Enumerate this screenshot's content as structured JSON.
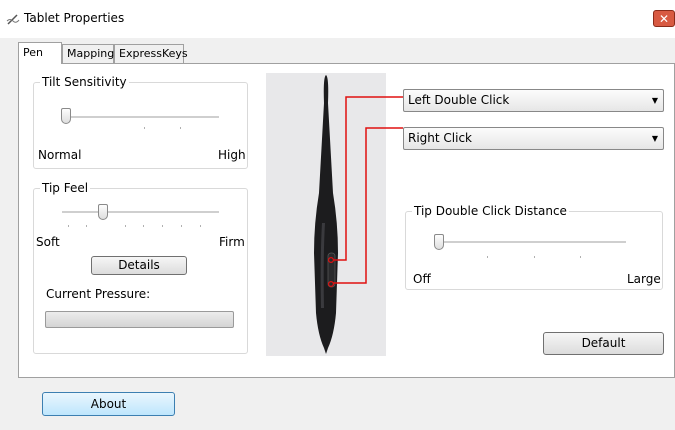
{
  "window": {
    "title": "Tablet Properties",
    "close_symbol": "✕"
  },
  "tabs": [
    {
      "label": "Pen",
      "active": true
    },
    {
      "label": "Mapping",
      "active": false
    },
    {
      "label": "ExpressKeys",
      "active": false
    }
  ],
  "tilt": {
    "title": "Tilt Sensitivity",
    "min_label": "Normal",
    "max_label": "High",
    "level": 0
  },
  "tip_feel": {
    "title": "Tip Feel",
    "min_label": "Soft",
    "max_label": "Firm",
    "details_label": "Details",
    "pressure_label": "Current Pressure:",
    "level": 0.25,
    "pressure_value": 0
  },
  "pen_buttons": {
    "upper": {
      "selected": "Left Double Click"
    },
    "lower": {
      "selected": "Right Click"
    }
  },
  "double_click": {
    "title": "Tip Double Click Distance",
    "min_label": "Off",
    "max_label": "Large",
    "level": 0
  },
  "default_label": "Default",
  "about_label": "About",
  "colors": {
    "callout_line": "#e01010",
    "about_border": "#3c7fb1"
  }
}
